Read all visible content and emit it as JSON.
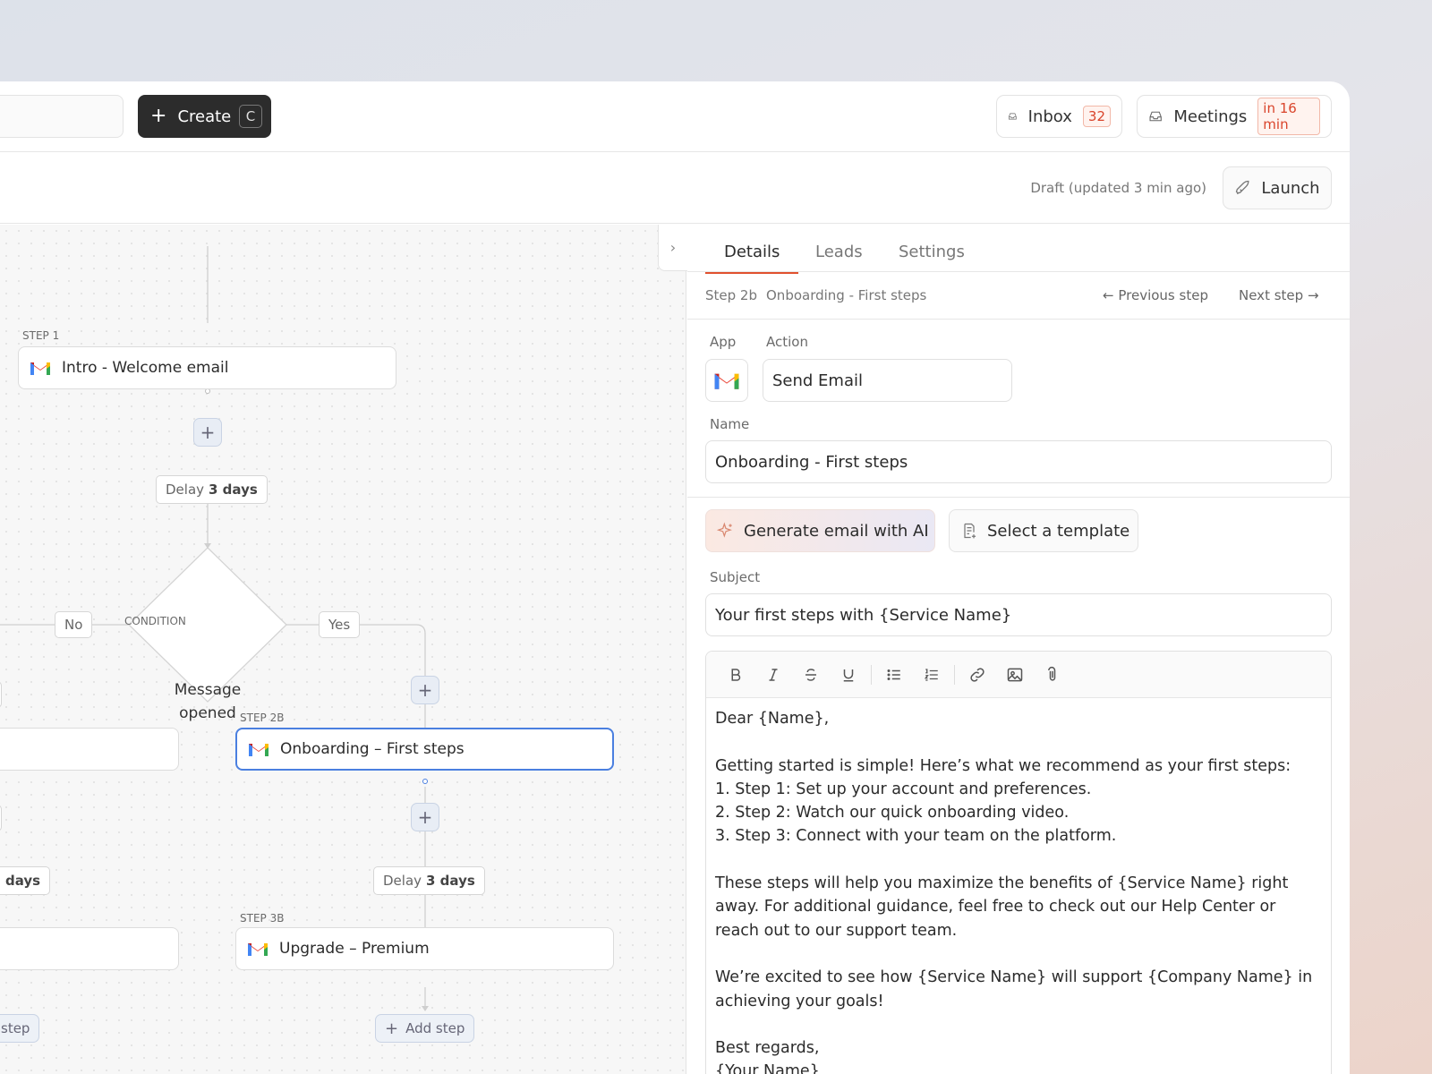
{
  "topbar": {
    "create_label": "Create",
    "create_shortcut": "C",
    "inbox_label": "Inbox",
    "inbox_count": "32",
    "meetings_label": "Meetings",
    "meetings_badge": "in 16 min"
  },
  "status": {
    "draft_text": "Draft (updated 3 min ago)",
    "launch_label": "Launch"
  },
  "canvas": {
    "step1": {
      "label": "STEP 1",
      "title": "Intro - Welcome email"
    },
    "delay1": {
      "prefix": "Delay",
      "value": "3 days"
    },
    "condition_label": "CONDITION",
    "condition_text_line1": "Message",
    "condition_text_line2": "opened",
    "no_label": "No",
    "yes_label": "Yes",
    "step2b": {
      "label": "STEP 2B",
      "title": "Onboarding – First steps"
    },
    "delay2": {
      "prefix": "Delay",
      "value": "3 days"
    },
    "delay_left_partial": "days",
    "step3b": {
      "label": "STEP 3B",
      "title": "Upgrade – Premium"
    },
    "add_step_label": "Add step",
    "add_step_left_partial": "step"
  },
  "panel": {
    "tabs": [
      {
        "label": "Details"
      },
      {
        "label": "Leads"
      },
      {
        "label": "Settings"
      }
    ],
    "crumb_step": "Step 2b",
    "crumb_name": "Onboarding - First steps",
    "prev_label": "Previous step",
    "next_label": "Next step",
    "app_label": "App",
    "action_label": "Action",
    "action_value": "Send Email",
    "name_label": "Name",
    "name_value": "Onboarding - First steps",
    "ai_button": "Generate email with AI",
    "template_button": "Select a template",
    "subject_label": "Subject",
    "subject_value": "Your first steps with {Service Name}",
    "body_lines": [
      "Dear {Name},",
      "",
      "Getting started is simple! Here’s what we recommend as your first steps:",
      "1. Step 1: Set up your account and preferences.",
      "2. Step 2: Watch our quick onboarding video.",
      "3. Step 3: Connect with your team on the platform.",
      "",
      "These steps will help you maximize the benefits of {Service Name} right away. For additional guidance, feel free to check out our Help Center or reach out to our support team.",
      "",
      "We’re excited to see how {Service Name} will support {Company Name} in achieving your goals!",
      "",
      "Best regards,",
      "{Your Name}"
    ]
  },
  "colors": {
    "accent": "#e0502e",
    "selected": "#4a7fe0",
    "dark_button": "#2c2c2c"
  },
  "icons": [
    "plus-icon",
    "inbox-icon",
    "rocket-icon",
    "chevron-right-icon",
    "gmail-icon",
    "arrow-left-icon",
    "arrow-right-icon",
    "sparkle-icon",
    "template-icon",
    "bold-icon",
    "italic-icon",
    "strikethrough-icon",
    "underline-icon",
    "bullet-list-icon",
    "numbered-list-icon",
    "link-icon",
    "image-icon",
    "attachment-icon"
  ]
}
